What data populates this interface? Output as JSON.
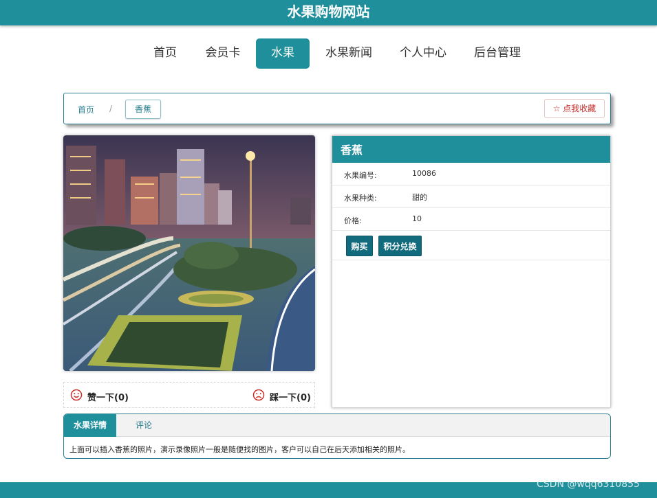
{
  "site": {
    "title": "水果购物网站"
  },
  "nav": {
    "items": [
      {
        "label": "首页",
        "active": false
      },
      {
        "label": "会员卡",
        "active": false
      },
      {
        "label": "水果",
        "active": true
      },
      {
        "label": "水果新闻",
        "active": false
      },
      {
        "label": "个人中心",
        "active": false
      },
      {
        "label": "后台管理",
        "active": false
      }
    ]
  },
  "breadcrumb": {
    "home": "首页",
    "separator": "/",
    "current": "香蕉"
  },
  "favorite": {
    "label": "点我收藏",
    "icon": "star-outline-icon"
  },
  "photo": {
    "description_icon": "city-night-photo"
  },
  "votes": {
    "like": {
      "label": "赞一下(0)",
      "icon": "smiley-icon"
    },
    "dislike": {
      "label": "踩一下(0)",
      "icon": "sad-face-icon"
    }
  },
  "product": {
    "name": "香蕉",
    "fields": [
      {
        "key": "水果编号:",
        "value": "10086"
      },
      {
        "key": "水果种类:",
        "value": "甜的"
      },
      {
        "key": "价格:",
        "value": "10"
      }
    ],
    "buy_label": "购买",
    "redeem_label": "积分兑换"
  },
  "tabs": {
    "items": [
      {
        "label": "水果详情",
        "active": true
      },
      {
        "label": "评论",
        "active": false
      }
    ],
    "content": "上面可以插入香蕉的照片，演示录像照片一般是随便找的图片，客户可以自己在后天添加相关的照片。"
  },
  "watermark": "CSDN @wqq6310855",
  "colors": {
    "brand": "#1e8f9b",
    "button": "#126b7d",
    "favorite": "#c9302c"
  }
}
